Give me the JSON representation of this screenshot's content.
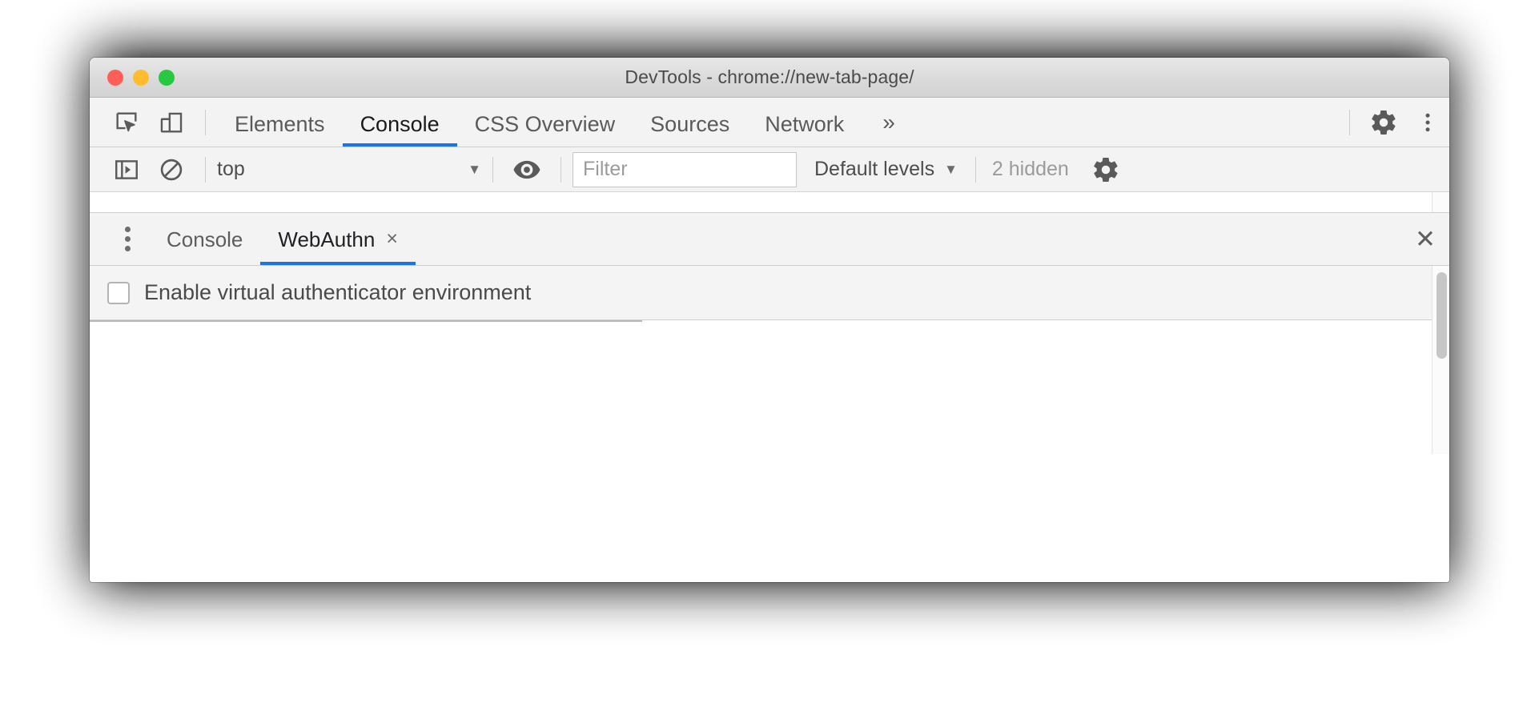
{
  "window": {
    "title": "DevTools - chrome://new-tab-page/",
    "traffic_lights": {
      "close": "close-window",
      "minimize": "minimize-window",
      "zoom": "zoom-window"
    },
    "colors": {
      "accent_blue": "#1a73e8",
      "titlebar_bg": "#d9d9d9",
      "toolbar_bg": "#f3f3f3",
      "red": "#ff5f57",
      "yellow": "#febc2e",
      "green": "#28c840"
    }
  },
  "main_toolbar": {
    "inspect_icon": "inspect-element-icon",
    "device_toggle_icon": "device-toolbar-icon",
    "tabs": [
      {
        "label": "Elements",
        "active": false
      },
      {
        "label": "Console",
        "active": true
      },
      {
        "label": "CSS Overview",
        "active": false
      },
      {
        "label": "Sources",
        "active": false
      },
      {
        "label": "Network",
        "active": false
      }
    ],
    "overflow": "»",
    "settings_icon": "gear-icon",
    "more_icon": "kebab-menu-icon"
  },
  "console_toolbar": {
    "sidebar_toggle_icon": "console-sidebar-icon",
    "clear_icon": "clear-console-icon",
    "context": {
      "value": "top",
      "caret": "▼"
    },
    "eye_icon": "live-expression-icon",
    "filter": {
      "value": "",
      "placeholder": "Filter"
    },
    "levels": {
      "value": "Default levels",
      "caret": "▼"
    },
    "hidden_count": "2 hidden",
    "settings_icon": "console-settings-gear-icon"
  },
  "drawer": {
    "menu_icon": "drawer-more-tabs-icon",
    "tabs": [
      {
        "label": "Console",
        "active": false,
        "closeable": false
      },
      {
        "label": "WebAuthn",
        "active": true,
        "closeable": true,
        "close": "×"
      }
    ],
    "close": "✕",
    "webauthn": {
      "enable_label": "Enable virtual authenticator environment",
      "enabled": false
    }
  }
}
